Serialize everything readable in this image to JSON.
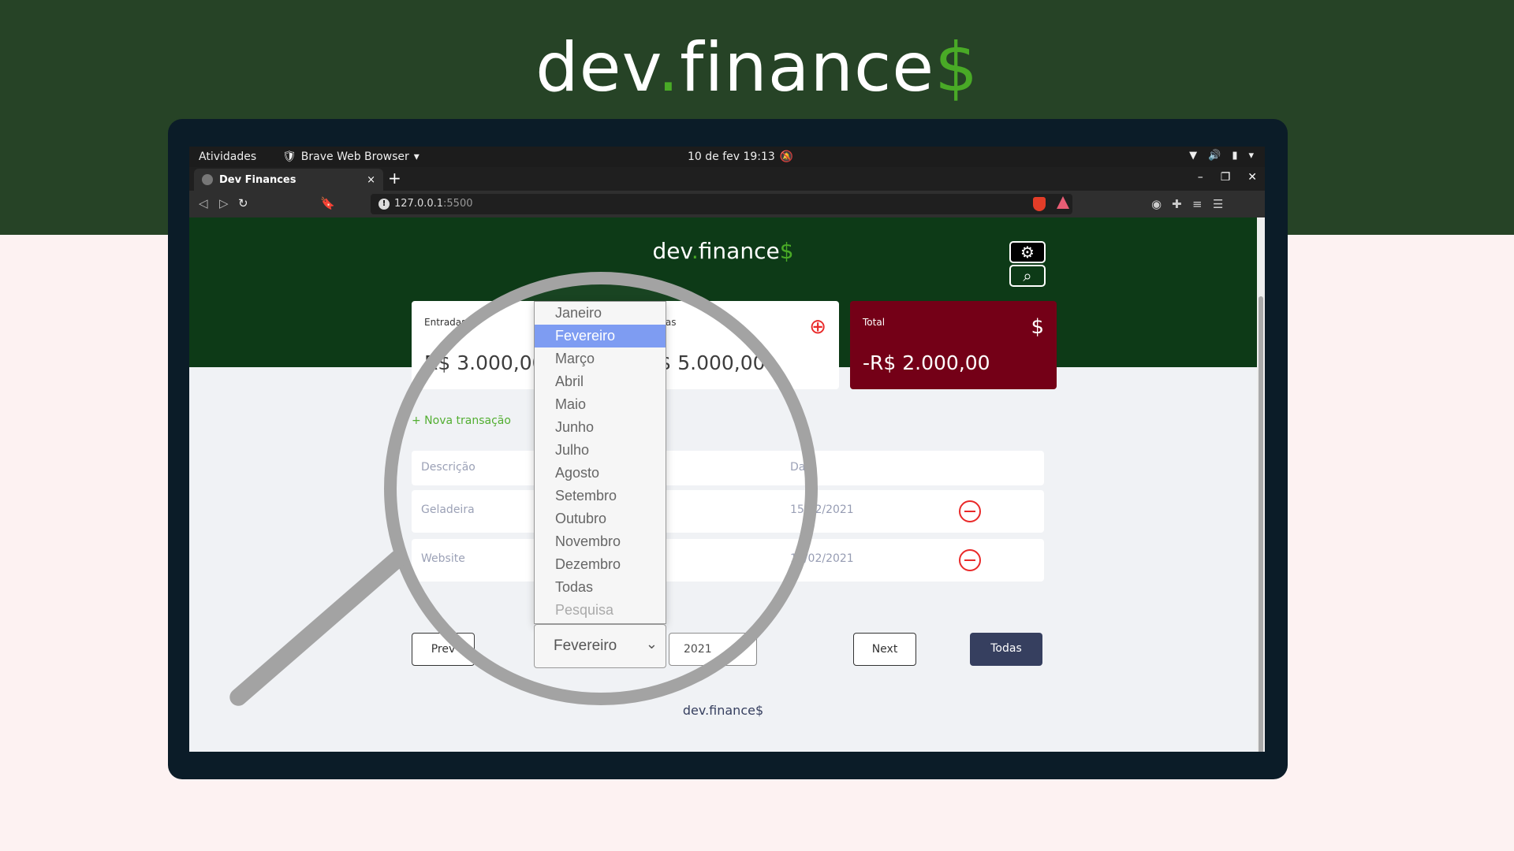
{
  "hero": {
    "title_pre": "dev",
    "title_dot": ".",
    "title_post": "finance",
    "title_dollar": "$"
  },
  "os_bar": {
    "activities": "Atividades",
    "app_name": "Brave Web Browser",
    "clock": "10 de fev  19:13"
  },
  "browser": {
    "tab_title": "Dev Finances",
    "tab_close": "×",
    "new_tab": "+",
    "url_host": "127.0.0.1",
    "url_port": ":5500"
  },
  "app": {
    "logo_pre": "dev",
    "logo_dot": ".",
    "logo_post": "finance",
    "logo_dollar": "$",
    "cards": {
      "income_label": "Entradas",
      "income_value": "R$ 3.000,00",
      "expense_label": "Saídas",
      "expense_value": "R$ 5.000,00",
      "total_label": "Total",
      "total_value": "-R$ 2.000,00"
    },
    "new_transaction": "+ Nova transação",
    "table": {
      "col_description": "Descrição",
      "col_date": "Data",
      "rows": [
        {
          "description": "Geladeira",
          "date": "15/02/2021"
        },
        {
          "description": "Website",
          "date": "10/02/2021"
        }
      ]
    },
    "controls": {
      "prev": "Prev",
      "month_selected": "Fevereiro",
      "year_selected": "2021",
      "next": "Next",
      "all": "Todas"
    },
    "footer": "dev.finance$"
  },
  "dropdown": {
    "options": [
      "Janeiro",
      "Fevereiro",
      "Março",
      "Abril",
      "Maio",
      "Junho",
      "Julho",
      "Agosto",
      "Setembro",
      "Outubro",
      "Novembro",
      "Dezembro",
      "Todas",
      "Pesquisa"
    ],
    "selected_index": 1
  },
  "colors": {
    "brand_green": "#49aa26",
    "header_dark": "#0d3a17",
    "total_card": "#740017",
    "hero_bg": "#264326"
  }
}
